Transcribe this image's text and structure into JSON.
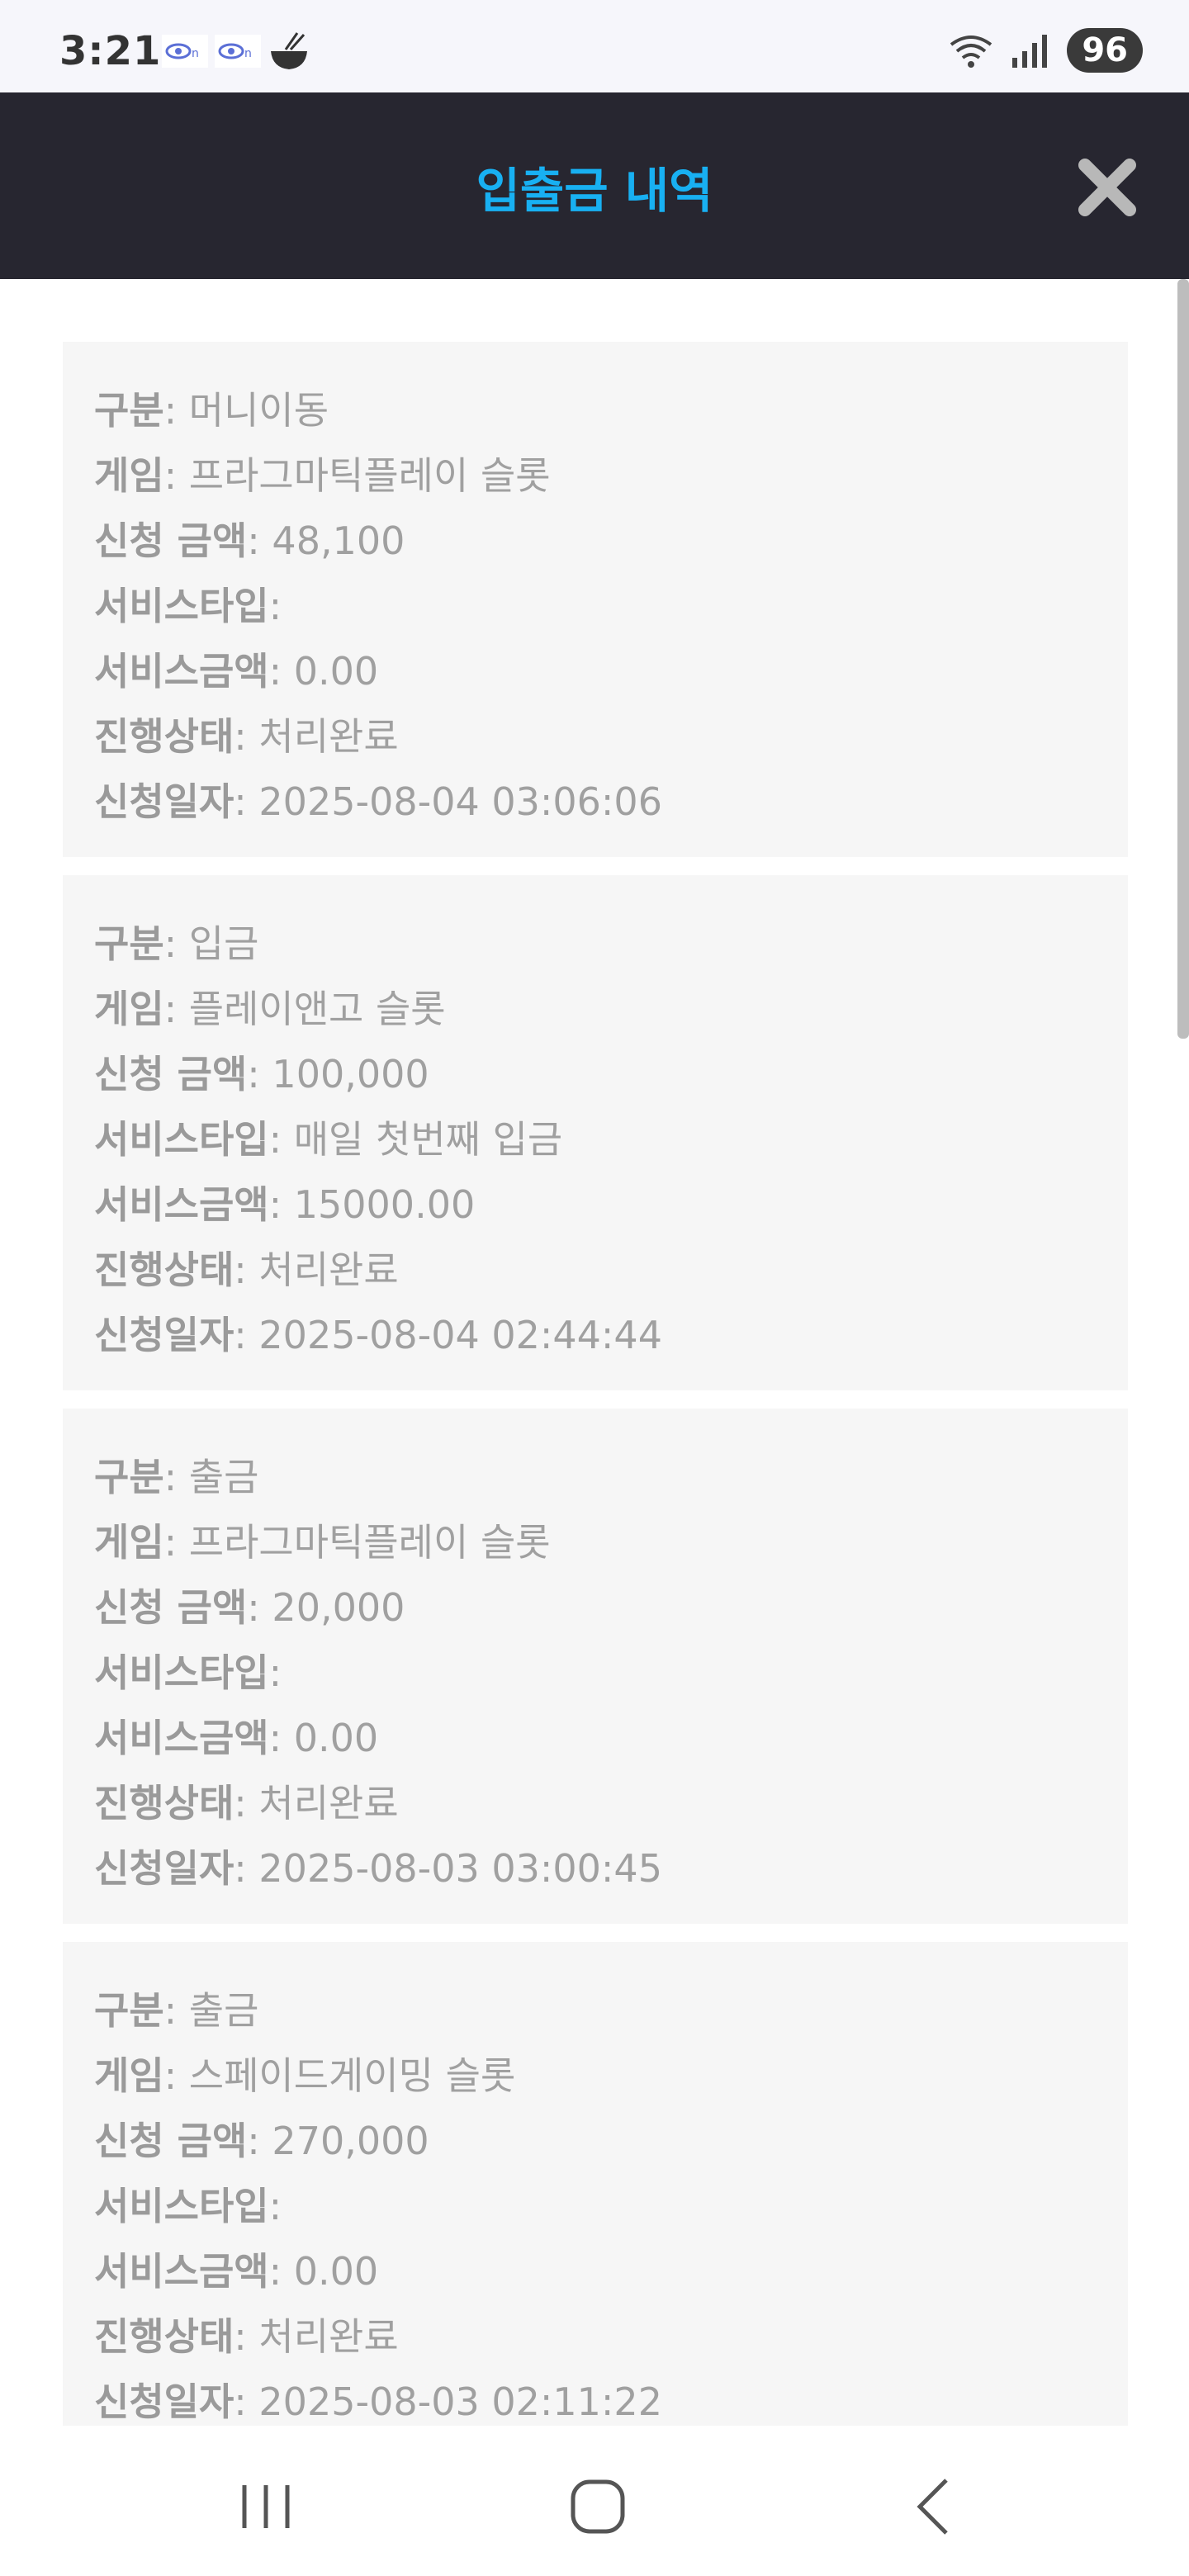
{
  "status_bar": {
    "time": "3:21",
    "battery": "96",
    "icons": [
      "link-app-icon",
      "link-app-icon",
      "bowl-app-icon",
      "wifi-icon",
      "signal-icon"
    ]
  },
  "header": {
    "title": "입출금 내역",
    "title_color": "#18b0f2",
    "background": "#272630",
    "close_icon": "close-icon"
  },
  "labels": {
    "type": "구분",
    "game": "게임",
    "amount": "신청 금액",
    "service_type": "서비스타입",
    "service_amount": "서비스금액",
    "status": "진행상태",
    "date": "신청일자"
  },
  "records": [
    {
      "type": "머니이동",
      "game": "프라그마틱플레이 슬롯",
      "amount": "48,100",
      "service_type": "",
      "service_amount": "0.00",
      "status": "처리완료",
      "date": "2025-08-04 03:06:06"
    },
    {
      "type": "입금",
      "game": "플레이앤고 슬롯",
      "amount": "100,000",
      "service_type": "매일 첫번째 입금",
      "service_amount": "15000.00",
      "status": "처리완료",
      "date": "2025-08-04 02:44:44"
    },
    {
      "type": "출금",
      "game": "프라그마틱플레이 슬롯",
      "amount": "20,000",
      "service_type": "",
      "service_amount": "0.00",
      "status": "처리완료",
      "date": "2025-08-03 03:00:45"
    },
    {
      "type": "출금",
      "game": "스페이드게이밍 슬롯",
      "amount": "270,000",
      "service_type": "",
      "service_amount": "0.00",
      "status": "처리완료",
      "date": "2025-08-03 02:11:22"
    }
  ],
  "nav_bar": {
    "icons": [
      "recent-apps-icon",
      "home-icon",
      "back-icon"
    ]
  }
}
